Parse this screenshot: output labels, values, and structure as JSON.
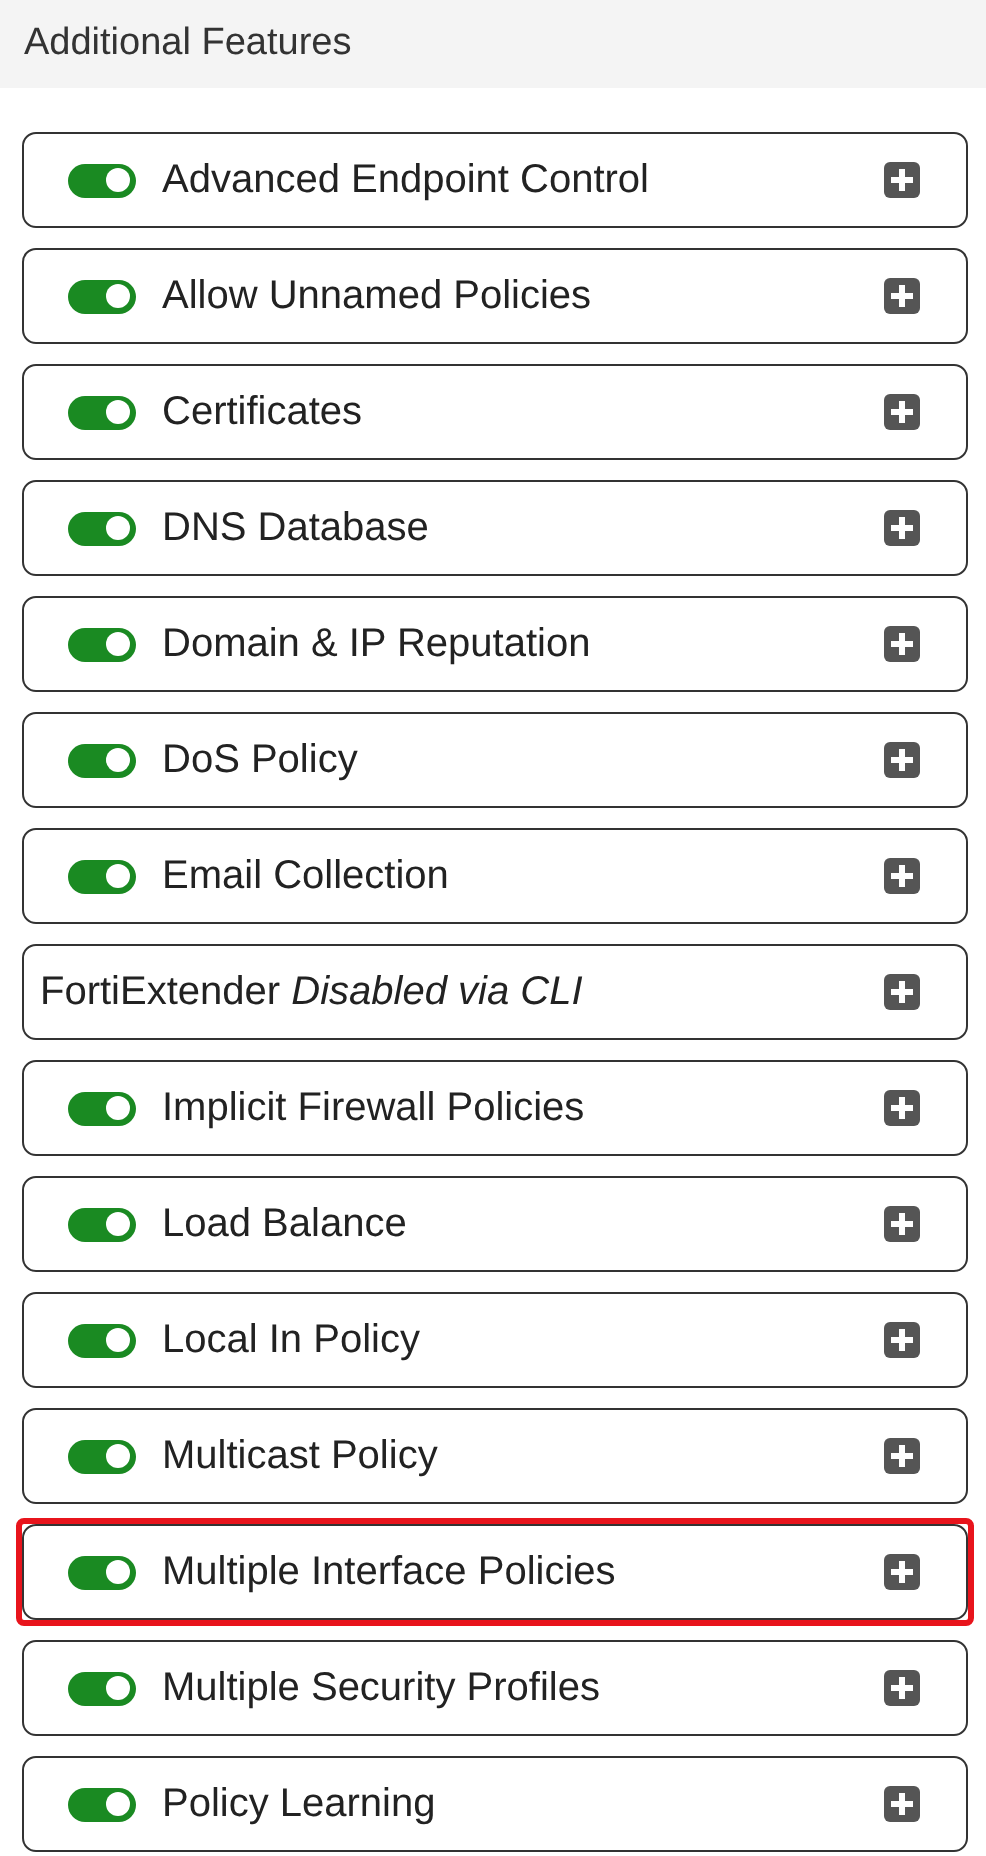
{
  "section": {
    "title": "Additional Features"
  },
  "features": [
    {
      "kind": "toggle",
      "label": "Advanced Endpoint Control",
      "on": true,
      "highlighted": false
    },
    {
      "kind": "toggle",
      "label": "Allow Unnamed Policies",
      "on": true,
      "highlighted": false
    },
    {
      "kind": "toggle",
      "label": "Certificates",
      "on": true,
      "highlighted": false
    },
    {
      "kind": "toggle",
      "label": "DNS Database",
      "on": true,
      "highlighted": false
    },
    {
      "kind": "toggle",
      "label": "Domain & IP Reputation",
      "on": true,
      "highlighted": false
    },
    {
      "kind": "toggle",
      "label": "DoS Policy",
      "on": true,
      "highlighted": false
    },
    {
      "kind": "toggle",
      "label": "Email Collection",
      "on": true,
      "highlighted": false
    },
    {
      "kind": "note",
      "label": "FortiExtender",
      "note": "Disabled via CLI",
      "highlighted": false
    },
    {
      "kind": "toggle",
      "label": "Implicit Firewall Policies",
      "on": true,
      "highlighted": false
    },
    {
      "kind": "toggle",
      "label": "Load Balance",
      "on": true,
      "highlighted": false
    },
    {
      "kind": "toggle",
      "label": "Local In Policy",
      "on": true,
      "highlighted": false
    },
    {
      "kind": "toggle",
      "label": "Multicast Policy",
      "on": true,
      "highlighted": false
    },
    {
      "kind": "toggle",
      "label": "Multiple Interface Policies",
      "on": true,
      "highlighted": true
    },
    {
      "kind": "toggle",
      "label": "Multiple Security Profiles",
      "on": true,
      "highlighted": false
    },
    {
      "kind": "toggle",
      "label": "Policy Learning",
      "on": true,
      "highlighted": false
    }
  ]
}
